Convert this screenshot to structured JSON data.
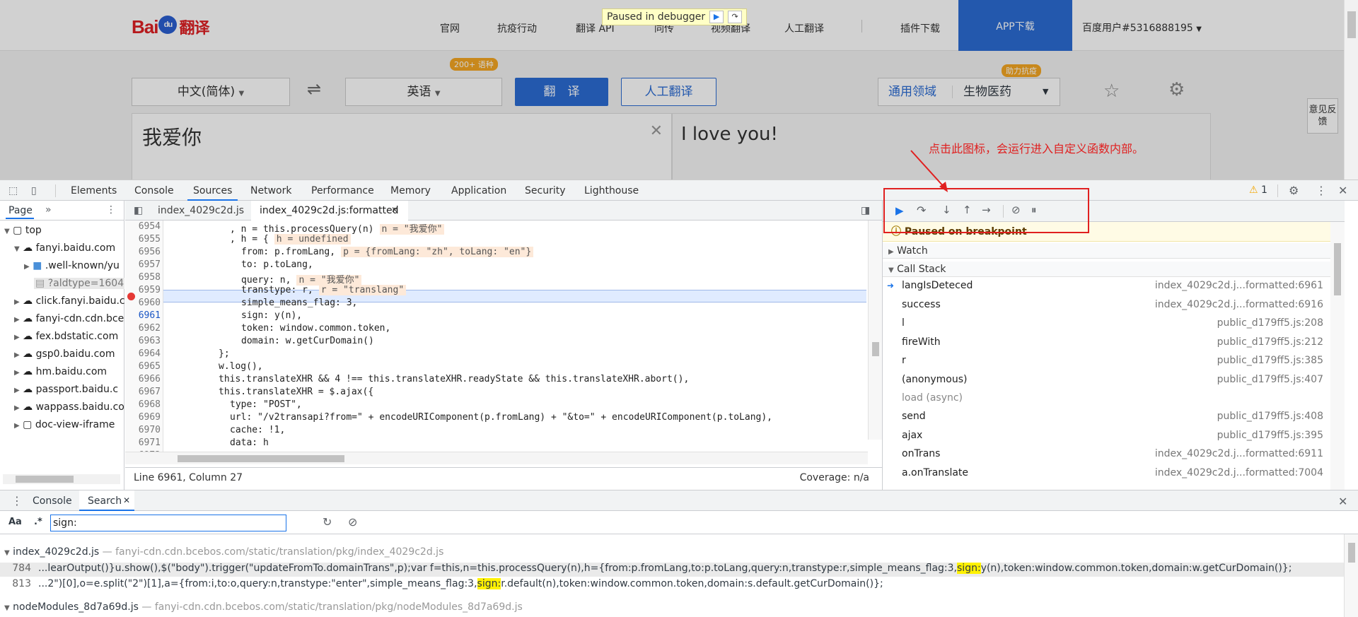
{
  "site": {
    "nav": [
      "官网",
      "抗疫行动",
      "翻译 API",
      "同传",
      "视频翻译",
      "人工翻译",
      "插件下载"
    ],
    "app_download": "APP下载",
    "user": "百度用户#5316888195",
    "paused_label": "Paused in debugger",
    "source_lang": "中文(简体)",
    "target_lang": "英语",
    "badge_200": "200+ 语种",
    "translate_btn": "翻　译",
    "human_btn": "人工翻译",
    "assist_badge": "助力抗疫",
    "domain_general": "通用领域",
    "domain_selected": "生物医药",
    "input_text": "我爱你",
    "output_text": "I love you!",
    "feedback": "意见反馈",
    "annotation": "点击此图标，会运行进入自定义函数内部。"
  },
  "devtools": {
    "tabs": [
      "Elements",
      "Console",
      "Sources",
      "Network",
      "Performance",
      "Memory",
      "Application",
      "Security",
      "Lighthouse"
    ],
    "active_tab": "Sources",
    "warning_count": "1",
    "sidebar": {
      "tab": "Page",
      "tree": [
        "top",
        "fanyi.baidu.com",
        ".well-known/yu",
        "?aldtype=1604",
        "click.fanyi.baidu.c",
        "fanyi-cdn.cdn.bce",
        "fex.bdstatic.com",
        "gsp0.baidu.com",
        "hm.baidu.com",
        "passport.baidu.c",
        "wappass.baidu.co",
        "doc-view-iframe"
      ]
    },
    "file_tabs": [
      "index_4029c2d.js",
      "index_4029c2d.js:formatted"
    ],
    "code": {
      "line_numbers": [
        "6954",
        "6955",
        "6956",
        "6957",
        "6958",
        "6959",
        "6960",
        "6961",
        "6962",
        "6963",
        "6964",
        "6965",
        "6966",
        "6967",
        "6968",
        "6969",
        "6970",
        "6971",
        "6972"
      ],
      "lines": [
        ", n = this.processQuery(n)",
        ", h = {",
        "from: p.fromLang,",
        "to: p.toLang,",
        "query: n,",
        "transtype: r,",
        "simple_means_flag: 3,",
        "sign: y(n),",
        "token: window.common.token,",
        "domain: w.getCurDomain()",
        "};",
        "w.log(),",
        "this.translateXHR && 4 !== this.translateXHR.readyState && this.translateXHR.abort(),",
        "this.translateXHR = $.ajax({",
        "type: \"POST\",",
        "url: \"/v2transapi?from=\" + encodeURIComponent(p.fromLang) + \"&to=\" + encodeURIComponent(p.toLang),",
        "cache: !1,",
        "data: h",
        ""
      ],
      "inline_values": {
        "l6954": "n = \"我爱你\"",
        "l6955": "h = undefined",
        "l6956": "p = {fromLang: \"zh\", toLang: \"en\"}",
        "l6958": "n = \"我爱你\"",
        "l6959": "r = \"translang\""
      }
    },
    "status": {
      "position": "Line 6961, Column 27",
      "coverage": "Coverage: n/a"
    },
    "debugger": {
      "paused": "Paused on breakpoint",
      "watch": "Watch",
      "call_stack": "Call Stack",
      "frames": [
        {
          "fn": "langIsDeteced",
          "loc": "index_4029c2d.j...formatted:6961"
        },
        {
          "fn": "success",
          "loc": "index_4029c2d.j...formatted:6916"
        },
        {
          "fn": "l",
          "loc": "public_d179ff5.js:208"
        },
        {
          "fn": "fireWith",
          "loc": "public_d179ff5.js:212"
        },
        {
          "fn": "r",
          "loc": "public_d179ff5.js:385"
        },
        {
          "fn": "(anonymous)",
          "loc": "public_d179ff5.js:407"
        }
      ],
      "async_label": "load (async)",
      "frames2": [
        {
          "fn": "send",
          "loc": "public_d179ff5.js:408"
        },
        {
          "fn": "ajax",
          "loc": "public_d179ff5.js:395"
        },
        {
          "fn": "onTrans",
          "loc": "index_4029c2d.j...formatted:6911"
        },
        {
          "fn": "a.onTranslate",
          "loc": "index_4029c2d.j...formatted:7004"
        }
      ]
    },
    "drawer": {
      "tabs": [
        "Console",
        "Search"
      ],
      "case_label": "Aa",
      "regex_label": ".*",
      "query": "sign:",
      "results": [
        {
          "file": "index_4029c2d.js",
          "path": "fanyi-cdn.cdn.bcebos.com/static/translation/pkg/index_4029c2d.js"
        },
        {
          "file": "nodeModules_8d7a69d.js",
          "path": "fanyi-cdn.cdn.bcebos.com/static/translation/pkg/nodeModules_8d7a69d.js"
        }
      ],
      "matches": [
        {
          "line": "784",
          "before": "...learOutput()}u.show(),$(\"body\").trigger(\"updateFromTo.domainTrans\",p);var f=this,n=this.processQuery(n),h={from:p.fromLang,to:p.toLang,query:n,transtype:r,simple_means_flag:3,",
          "hit": "sign:",
          "after": "y(n),token:window.common.token,domain:w.getCurDomain()};"
        },
        {
          "line": "813",
          "before": "...2\")[0],o=e.split(\"2\")[1],a={from:i,to:o,query:n,transtype:\"enter\",simple_means_flag:3,",
          "hit": "sign:",
          "after": "r.default(n),token:window.common.token,domain:s.default.getCurDomain()};"
        }
      ]
    }
  }
}
